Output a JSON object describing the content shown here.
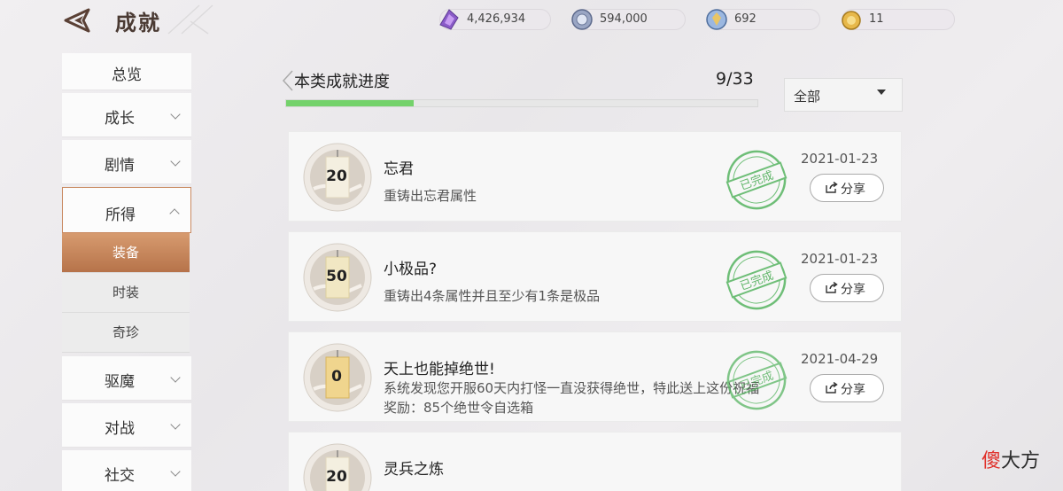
{
  "header": {
    "title": "成就",
    "currencies": [
      {
        "icon": "purple-crystal-icon",
        "value": "4,426,934"
      },
      {
        "icon": "silver-coin-icon",
        "value": "594,000"
      },
      {
        "icon": "blue-gem-icon",
        "value": "692"
      },
      {
        "icon": "gold-medal-icon",
        "value": "11"
      }
    ]
  },
  "sidebar": {
    "items": [
      {
        "label": "总览"
      },
      {
        "label": "成长"
      },
      {
        "label": "剧情"
      },
      {
        "label": "所得"
      },
      {
        "label": "驱魔"
      },
      {
        "label": "对战"
      },
      {
        "label": "社交"
      }
    ],
    "subitems": [
      {
        "label": "装备"
      },
      {
        "label": "时装"
      },
      {
        "label": "奇珍"
      }
    ]
  },
  "progress": {
    "title": "本类成就进度",
    "count": "9/33",
    "fraction": 0.27
  },
  "filter": {
    "value": "全部"
  },
  "achievements": [
    {
      "points": "20",
      "name": "忘君",
      "desc": "重铸出忘君属性",
      "stamp": "已完成",
      "date": "2021-01-23",
      "share": "分享"
    },
    {
      "points": "50",
      "name": "小极品?",
      "desc": "重铸出4条属性并且至少有1条是极品",
      "stamp": "已完成",
      "date": "2021-01-23",
      "share": "分享"
    },
    {
      "points": "0",
      "name": "天上也能掉绝世!",
      "desc": "系统发现您开服60天内打怪一直没获得绝世，特此送上这份祝福",
      "desc2": "奖励：85个绝世令自选箱",
      "stamp": "已完成",
      "date": "2021-04-29",
      "share": "分享"
    },
    {
      "points": "20",
      "name": "灵兵之炼"
    }
  ],
  "watermark": {
    "part1": "傻",
    "part2": "大方"
  },
  "colors": {
    "accent": "#b6734a",
    "progress": "#74d26b",
    "stamp": "#3fa84a"
  }
}
